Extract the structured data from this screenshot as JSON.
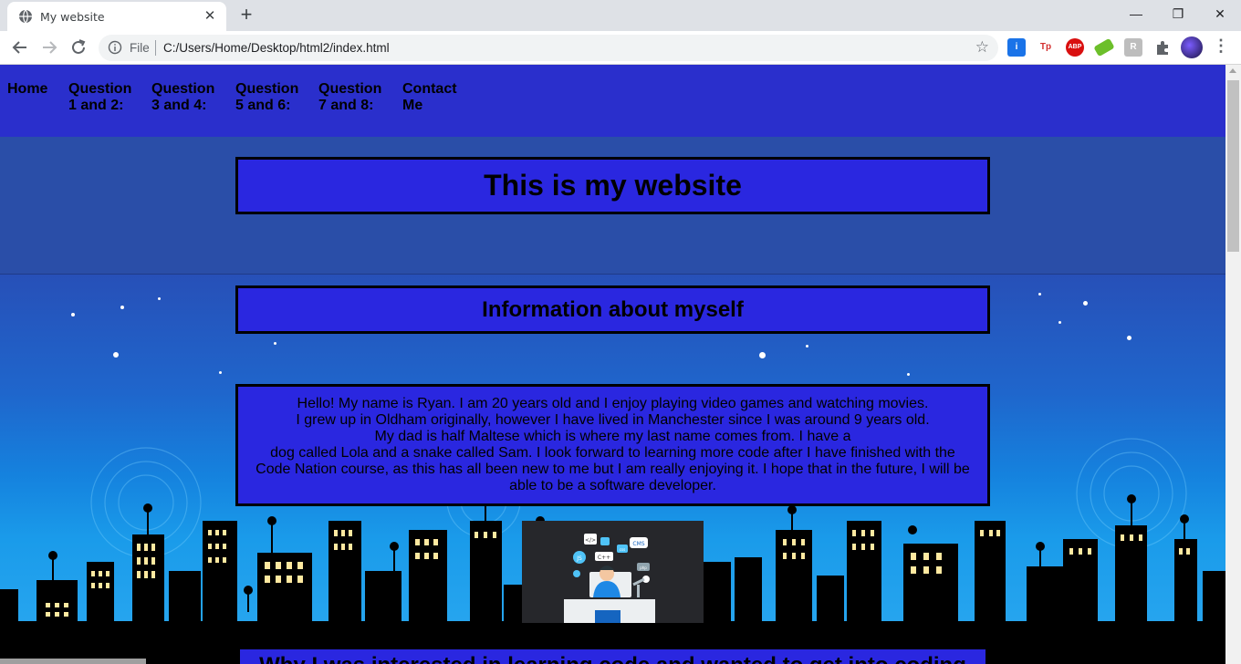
{
  "browser": {
    "tab_title": "My website",
    "tab_close": "✕",
    "new_tab": "+",
    "omnibox_file": "File",
    "url": "C:/Users/Home/Desktop/html2/index.html",
    "window_controls": [
      "—",
      "❐",
      "✕"
    ],
    "extensions": [
      {
        "name": "info-extension-icon",
        "label": "i",
        "color": "#1a73e8"
      },
      {
        "name": "tp-extension-icon",
        "label": "Tp",
        "color": "#ffffff"
      },
      {
        "name": "adblock-plus-icon",
        "label": "ABP",
        "color": "#d90f0f"
      },
      {
        "name": "green-extension-icon",
        "label": "",
        "color": "#6cbf2a"
      },
      {
        "name": "grey-extension-icon",
        "label": "R",
        "color": "#bdbdbd"
      }
    ]
  },
  "site": {
    "nav": [
      {
        "line1": "Home",
        "line2": ""
      },
      {
        "line1": "Question",
        "line2": "1 and 2:"
      },
      {
        "line1": "Question",
        "line2": "3 and 4:"
      },
      {
        "line1": "Question",
        "line2": "5 and 6:"
      },
      {
        "line1": "Question",
        "line2": "7 and 8:"
      },
      {
        "line1": "Contact",
        "line2": "Me"
      }
    ],
    "main_heading": "This is my website",
    "section_heading": "Information about myself",
    "about_lines": [
      "Hello! My name is Ryan. I am 20 years old and I enjoy playing video games and watching movies.",
      "I grew up in Oldham originally, however I have lived in Manchester since I was around 9 years old.",
      "My dad is half Maltese which is where my last name comes from. I have a",
      "dog called Lola and a snake called Sam. I look forward to learning more code after I have finished with the Code Nation course, as this has all been new to me but I am really enjoying it. I hope that in the future, I will be able to be a software developer."
    ],
    "bottom_heading_partial": "Why I was interested in learning code and wanted to get into coding",
    "image_labels": [
      "</>",
      "CMS",
      "JS",
      "C++",
      "css",
      "php"
    ]
  },
  "colors": {
    "nav_bg": "#2a2fcc",
    "box_bg": "#2a27e0",
    "box_border": "#000000"
  }
}
